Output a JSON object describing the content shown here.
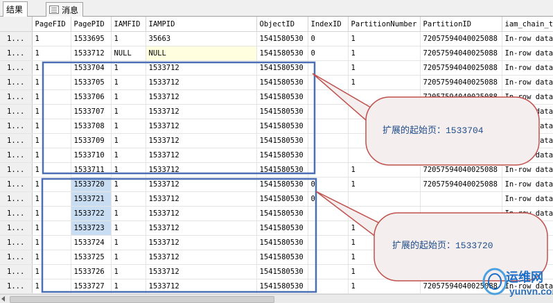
{
  "tabs": [
    {
      "label": "结果",
      "active": true
    },
    {
      "label": "消息",
      "active": false
    }
  ],
  "columns": [
    "",
    "PageFID",
    "PagePID",
    "IAMFID",
    "IAMPID",
    "ObjectID",
    "IndexID",
    "PartitionNumber",
    "PartitionID",
    "iam_chain_ty"
  ],
  "rows": [
    [
      "1...",
      "1",
      "1533695",
      "1",
      "35663",
      "1541580530",
      "0",
      "1",
      "72057594040025088",
      "In-row data"
    ],
    [
      "1...",
      "1",
      "1533712",
      "NULL",
      "NULL",
      "1541580530",
      "0",
      "1",
      "72057594040025088",
      "In-row data"
    ],
    [
      "1...",
      "1",
      "1533704",
      "1",
      "1533712",
      "1541580530",
      "",
      "1",
      "72057594040025088",
      "In-row data"
    ],
    [
      "1...",
      "1",
      "1533705",
      "1",
      "1533712",
      "1541580530",
      "",
      "1",
      "72057594040025088",
      "In-row data"
    ],
    [
      "1...",
      "1",
      "1533706",
      "1",
      "1533712",
      "1541580530",
      "",
      "",
      "72057594040025088",
      "In-row data"
    ],
    [
      "1...",
      "1",
      "1533707",
      "1",
      "1533712",
      "1541580530",
      "",
      "",
      "",
      "In-row data"
    ],
    [
      "1...",
      "1",
      "1533708",
      "1",
      "1533712",
      "1541580530",
      "",
      "",
      "",
      "In-row data"
    ],
    [
      "1...",
      "1",
      "1533709",
      "1",
      "1533712",
      "1541580530",
      "",
      "",
      "",
      "In-row data"
    ],
    [
      "1...",
      "1",
      "1533710",
      "1",
      "1533712",
      "1541580530",
      "",
      "",
      "72057594040025088",
      "In-row data"
    ],
    [
      "1...",
      "1",
      "1533711",
      "1",
      "1533712",
      "1541580530",
      "",
      "1",
      "72057594040025088",
      "In-row data"
    ],
    [
      "1...",
      "1",
      "1533720",
      "1",
      "1533712",
      "1541580530",
      "0",
      "1",
      "72057594040025088",
      "In-row data"
    ],
    [
      "1...",
      "1",
      "1533721",
      "1",
      "1533712",
      "1541580530",
      "0",
      "",
      "",
      "In-row data"
    ],
    [
      "1...",
      "1",
      "1533722",
      "1",
      "1533712",
      "1541580530",
      "",
      "1",
      "",
      "In-row data"
    ],
    [
      "1...",
      "1",
      "1533723",
      "1",
      "1533712",
      "1541580530",
      "",
      "1",
      "",
      ""
    ],
    [
      "1...",
      "1",
      "1533724",
      "1",
      "1533712",
      "1541580530",
      "",
      "1",
      "",
      ""
    ],
    [
      "1...",
      "1",
      "1533725",
      "1",
      "1533712",
      "1541580530",
      "",
      "1",
      "",
      ""
    ],
    [
      "1...",
      "1",
      "1533726",
      "1",
      "1533712",
      "1541580530",
      "",
      "1",
      "",
      ""
    ],
    [
      "1...",
      "1",
      "1533727",
      "1",
      "1533712",
      "1541580530",
      "",
      "1",
      "72057594040025088",
      "In-row data"
    ]
  ],
  "selected_rows": [
    10,
    11,
    12,
    13
  ],
  "callouts": [
    {
      "text": "扩展的起始页：1533704"
    },
    {
      "text": "扩展的起始页：1533720"
    }
  ],
  "watermark": {
    "cn": "运维网",
    "en": "yunvn.com"
  },
  "colors": {
    "callout_fill": "#f5eeee",
    "callout_stroke": "#c0504d",
    "box_stroke": "#4a6fb5",
    "selection": "#c8ddf2"
  }
}
